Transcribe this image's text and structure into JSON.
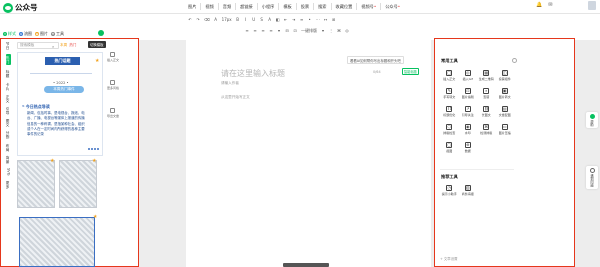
{
  "app": {
    "title": "公众号"
  },
  "menu": [
    {
      "label": "图片",
      "dropdown": true
    },
    {
      "label": "视频"
    },
    {
      "label": "音频"
    },
    {
      "label": "超链接"
    },
    {
      "label": "小程序"
    },
    {
      "label": "模板"
    },
    {
      "label": "投票"
    },
    {
      "label": "搜索"
    },
    {
      "label": "收藏位置"
    },
    {
      "label": "视频号",
      "badge": true
    },
    {
      "label": "公众号",
      "badge": true
    }
  ],
  "toolbar": {
    "row1": [
      "↶",
      "↷",
      "⌫",
      "A",
      "17px",
      "B",
      "I",
      "U",
      "S",
      "A",
      "◧",
      "⇤",
      "⇥",
      "≡",
      "•",
      "⋯",
      "↔",
      "⊞"
    ],
    "row2": [
      "≡",
      "≡",
      "≡",
      "≡",
      "▾",
      "⊟",
      "⊡",
      "一键排版",
      "▾",
      "⋮",
      "⌘",
      "◎"
    ]
  },
  "left_panel": {
    "tabs": [
      {
        "label": "样式",
        "active": true
      },
      {
        "label": "流图"
      },
      {
        "label": "图片"
      },
      {
        "label": "工具"
      }
    ],
    "tooltip": "切换模板",
    "categories": [
      "节日",
      "热门",
      "标题",
      "卡片",
      "正文",
      "引导",
      "图文",
      "分割",
      "布局",
      "背景",
      "SVG",
      "更多"
    ],
    "search_placeholder": "搜索模板",
    "filters": [
      "本周",
      "热门"
    ],
    "card": {
      "badge": "热门话题",
      "date": "• 2022 •",
      "pill": "本周热门事件",
      "article_title": "今日热点导读",
      "article_body": "新闻、包括时事、是电视台、报纸、电台、广播、电视台等媒体上报道的传播信息的一种称谓，是指某种社会、组织或个人在一定时间内所获得的各种主要事件的记录"
    },
    "side_strip": [
      {
        "label": "插入正文"
      },
      {
        "label": "更多风格"
      },
      {
        "label": "导出文章"
      }
    ]
  },
  "editor": {
    "title_placeholder": "请在这里输入标题",
    "author_placeholder": "请输入作者",
    "body_placeholder": "从这里开始写正文",
    "char_count": "0/64",
    "generate_title": "智能标题",
    "suggestion": "看看AI如何帮你写出标题和开头吧"
  },
  "right_panel": {
    "common_title": "常用工具",
    "common_tools": [
      {
        "icon": "□",
        "label": "插入正文"
      },
      {
        "icon": "◎",
        "label": "插入Gif"
      },
      {
        "icon": "▦",
        "label": "生成二维码"
      },
      {
        "icon": "◫",
        "label": "投票组件"
      },
      {
        "icon": "✎",
        "label": "手写转文"
      },
      {
        "icon": "⊡",
        "label": "图片编辑"
      },
      {
        "icon": "⌕",
        "label": "查错"
      },
      {
        "icon": "▣",
        "label": "图片转文"
      },
      {
        "icon": "Tt",
        "label": "标题优化"
      },
      {
        "icon": "↗",
        "label": "引导关注"
      },
      {
        "icon": "⛓",
        "label": "长图文"
      },
      {
        "icon": "▤",
        "label": "文章配图"
      },
      {
        "icon": "⬡",
        "label": "排版检查"
      },
      {
        "icon": "◉",
        "label": "水印"
      },
      {
        "icon": "⌘",
        "label": "检测排版"
      },
      {
        "icon": "▭",
        "label": "图片压缩"
      },
      {
        "icon": "▢",
        "label": "截图"
      },
      {
        "icon": "⊕",
        "label": "数据"
      }
    ],
    "recommend_title": "推荐工具",
    "recommend_tools": [
      {
        "icon": "◷",
        "label": "提示小助手"
      },
      {
        "icon": "▥",
        "label": "商务海报"
      }
    ],
    "footer": "+ 文章设置"
  },
  "float_buttons": [
    {
      "label": "帮助"
    },
    {
      "label": "遇到问题"
    }
  ]
}
